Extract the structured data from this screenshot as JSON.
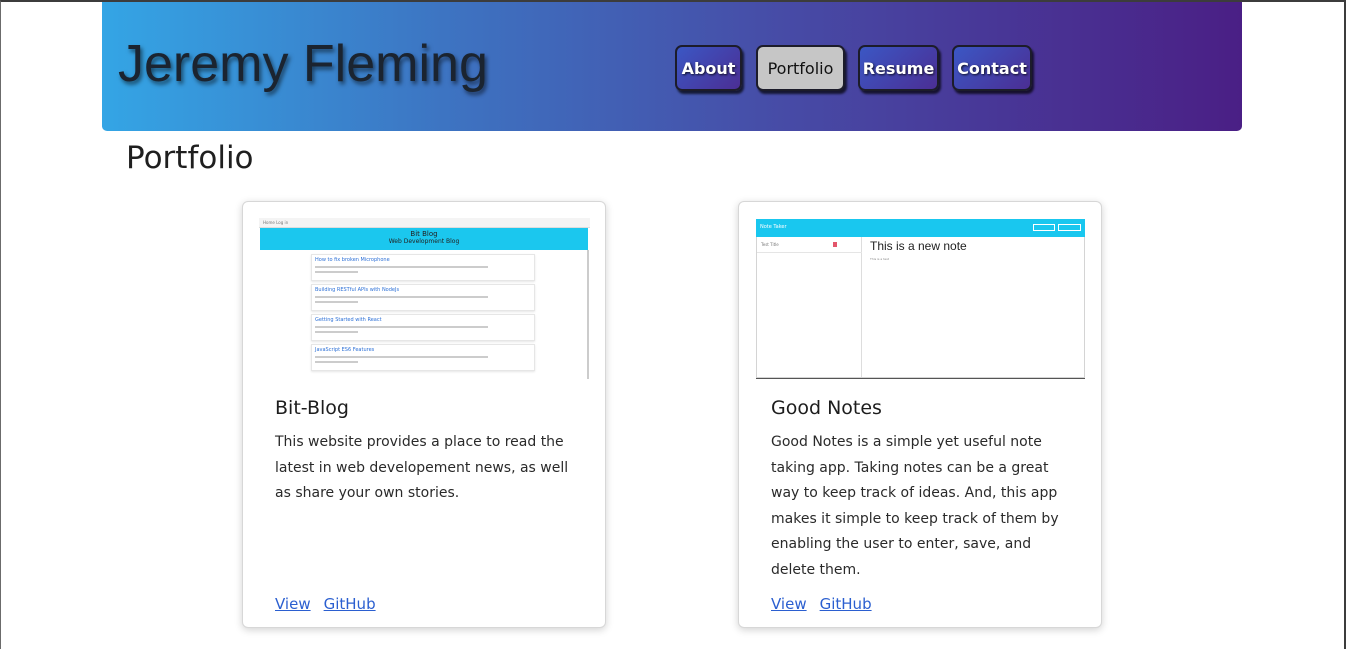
{
  "site": {
    "name": "Jeremy Fleming"
  },
  "nav": {
    "items": [
      {
        "label": "About",
        "active": false
      },
      {
        "label": "Portfolio",
        "active": true
      },
      {
        "label": "Resume",
        "active": false
      },
      {
        "label": "Contact",
        "active": false
      }
    ]
  },
  "page": {
    "title": "Portfolio"
  },
  "projects": [
    {
      "title": "Bit-Blog",
      "description": "This website provides a place to read the latest in web developement news, as well as share your own stories.",
      "links": {
        "view": "View",
        "github": "GitHub"
      },
      "thumbnail": {
        "topbar": "Home Log in",
        "banner_title": "Bit Blog",
        "banner_subtitle": "Web Development Blog",
        "posts": [
          "How to fix broken Microphone",
          "Building RESTful APIs with NodeJs",
          "Getting Started with React",
          "JavaScript ES6 Features"
        ]
      }
    },
    {
      "title": "Good Notes",
      "description": "Good Notes is a simple yet useful note taking app. Taking notes can be a great way to keep track of ideas. And, this app makes it simple to keep track of them by enabling the user to enter, save, and delete them.",
      "links": {
        "view": "View",
        "github": "GitHub"
      },
      "thumbnail": {
        "app_name": "Note Taker",
        "list_item": "Test Title",
        "note_title": "This is a new note",
        "note_text": "This is a test"
      }
    }
  ],
  "colors": {
    "header_gradient_start": "#34a5e5",
    "header_gradient_end": "#4a1f85",
    "link": "#2b5fd0",
    "thumbnail_accent": "#1bc7ee"
  }
}
